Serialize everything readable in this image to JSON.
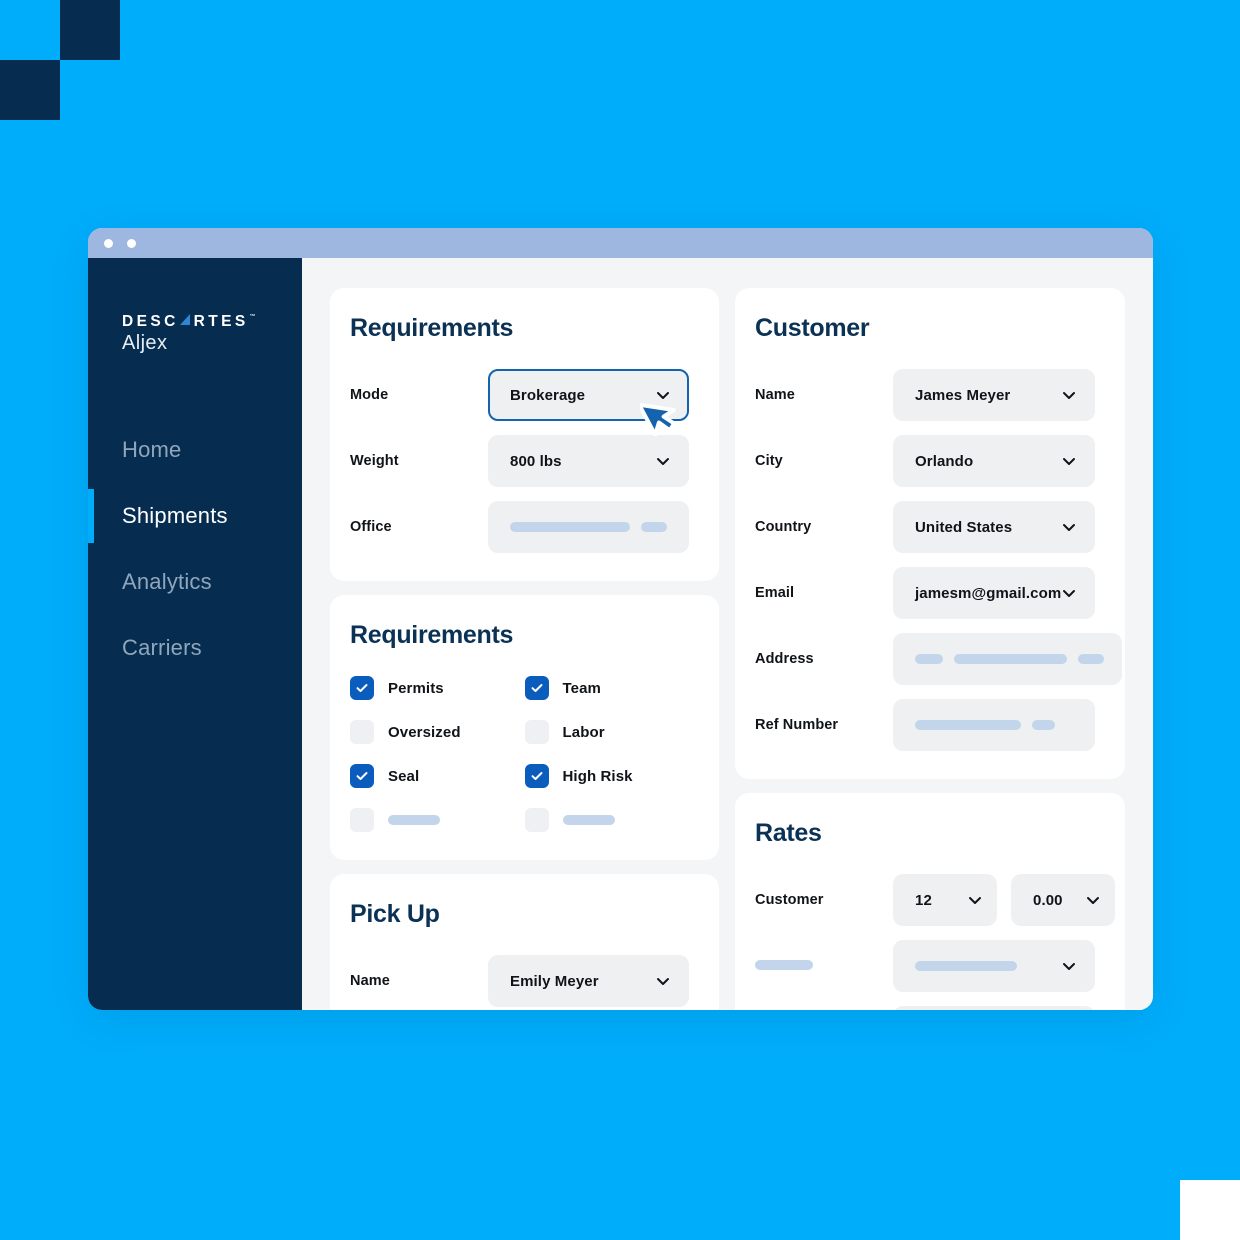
{
  "theme": {
    "page_bg": "#00ADFB",
    "sidebar_bg": "#062d50",
    "accent": "#00ADFB",
    "brand_blue": "#0b5dbd",
    "heading": "#0b3255",
    "field_bg": "#eff0f2",
    "skeleton": "#c2d5ea",
    "titlebar": "#9db7e0"
  },
  "window": {
    "titlebar_dots": [
      "dot-1",
      "dot-2"
    ]
  },
  "sidebar": {
    "logo": {
      "brand": "DESCARTES",
      "trademark": "™",
      "product": "Aljex"
    },
    "items": [
      {
        "label": "Home",
        "active": false
      },
      {
        "label": "Shipments",
        "active": true
      },
      {
        "label": "Analytics",
        "active": false
      },
      {
        "label": "Carriers",
        "active": false
      }
    ]
  },
  "cards": {
    "requirements_fields": {
      "title": "Requirements",
      "rows": [
        {
          "label": "Mode",
          "value": "Brokerage",
          "focused": true
        },
        {
          "label": "Weight",
          "value": "800 lbs",
          "focused": false
        },
        {
          "label": "Office",
          "value": "",
          "placeholder": true
        }
      ]
    },
    "requirements_checks": {
      "title": "Requirements",
      "items": [
        {
          "label": "Permits",
          "checked": true
        },
        {
          "label": "Team",
          "checked": true
        },
        {
          "label": "Oversized",
          "checked": false
        },
        {
          "label": "Labor",
          "checked": false
        },
        {
          "label": "Seal",
          "checked": true
        },
        {
          "label": "High Risk",
          "checked": true
        },
        {
          "label": "",
          "checked": false,
          "placeholder": true
        },
        {
          "label": "",
          "checked": false,
          "placeholder": true
        }
      ]
    },
    "pickup": {
      "title": "Pick Up",
      "rows": [
        {
          "label": "Name",
          "value": "Emily Meyer",
          "focused": false
        }
      ]
    },
    "customer": {
      "title": "Customer",
      "rows": [
        {
          "label": "Name",
          "value": "James Meyer"
        },
        {
          "label": "City",
          "value": "Orlando"
        },
        {
          "label": "Country",
          "value": "United States"
        },
        {
          "label": "Email",
          "value": "jamesm@gmail.com"
        },
        {
          "label": "Address",
          "value": "",
          "placeholder": true
        },
        {
          "label": "Ref Number",
          "value": "",
          "placeholder": true
        }
      ]
    },
    "rates": {
      "title": "Rates",
      "rows": [
        {
          "label": "Customer",
          "value_a": "12",
          "value_b": "0.00"
        },
        {
          "label": "",
          "value_a": "",
          "placeholder": true
        },
        {
          "label": "",
          "value_a": "",
          "placeholder": true
        }
      ]
    }
  },
  "cursor": {
    "name": "mouse-pointer"
  }
}
